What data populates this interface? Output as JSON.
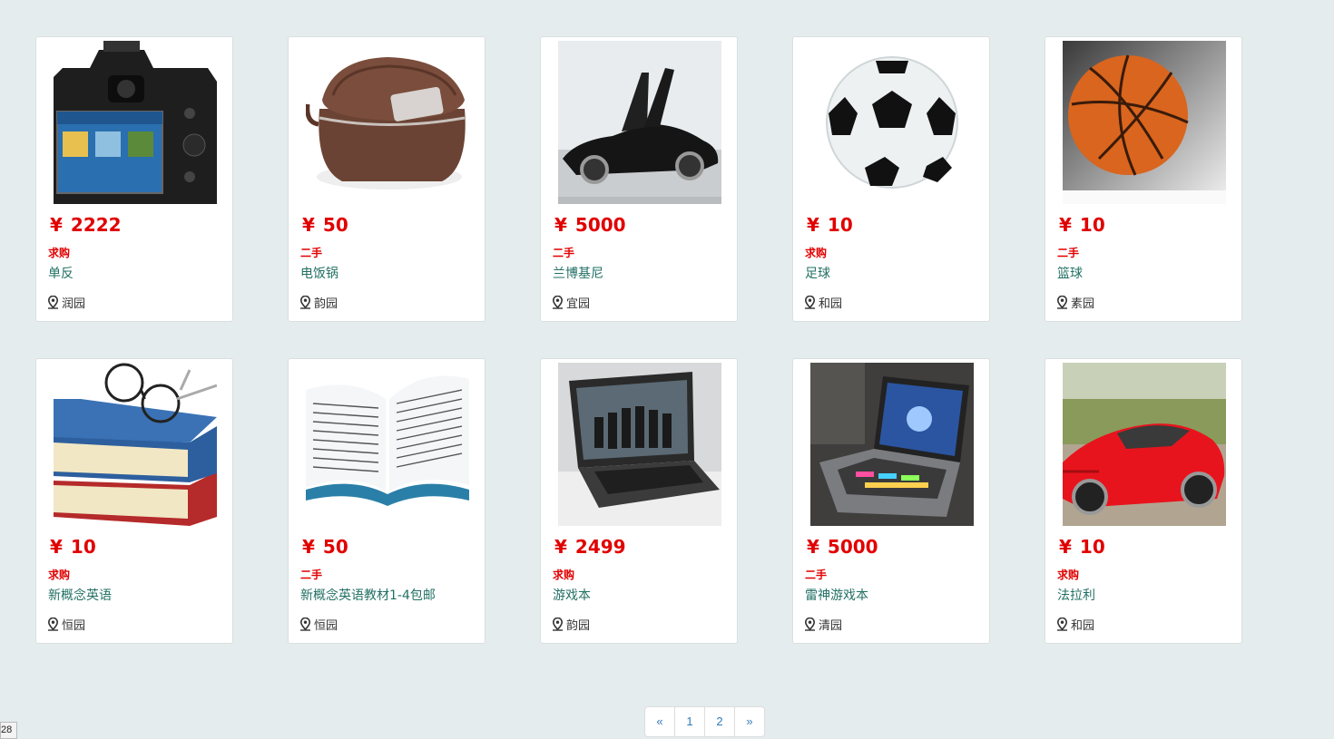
{
  "currency_symbol": "¥",
  "items": [
    {
      "price": "2222",
      "tag": "求购",
      "title": "单反",
      "location": "润园",
      "image": "dslr-camera"
    },
    {
      "price": "50",
      "tag": "二手",
      "title": "电饭锅",
      "location": "韵园",
      "image": "rice-cooker"
    },
    {
      "price": "5000",
      "tag": "二手",
      "title": "兰博基尼",
      "location": "宜园",
      "image": "lamborghini-car"
    },
    {
      "price": "10",
      "tag": "求购",
      "title": "足球",
      "location": "和园",
      "image": "soccer-ball"
    },
    {
      "price": "10",
      "tag": "二手",
      "title": "篮球",
      "location": "素园",
      "image": "basketball"
    },
    {
      "price": "10",
      "tag": "求购",
      "title": "新概念英语",
      "location": "恒园",
      "image": "books-glasses"
    },
    {
      "price": "50",
      "tag": "二手",
      "title": "新概念英语教材1-4包邮",
      "location": "恒园",
      "image": "open-book"
    },
    {
      "price": "2499",
      "tag": "求购",
      "title": "游戏本",
      "location": "韵园",
      "image": "gaming-laptop"
    },
    {
      "price": "5000",
      "tag": "二手",
      "title": "雷神游戏本",
      "location": "清园",
      "image": "thunderobot-laptop"
    },
    {
      "price": "10",
      "tag": "求购",
      "title": "法拉利",
      "location": "和园",
      "image": "ferrari-car"
    }
  ],
  "pagination": {
    "prev": "«",
    "pages": [
      "1",
      "2"
    ],
    "next": "»"
  },
  "corner_badge": "28",
  "colors": {
    "background": "#e4eced",
    "price": "#e10000",
    "title_link": "#227064",
    "pager_link": "#337ab7"
  }
}
